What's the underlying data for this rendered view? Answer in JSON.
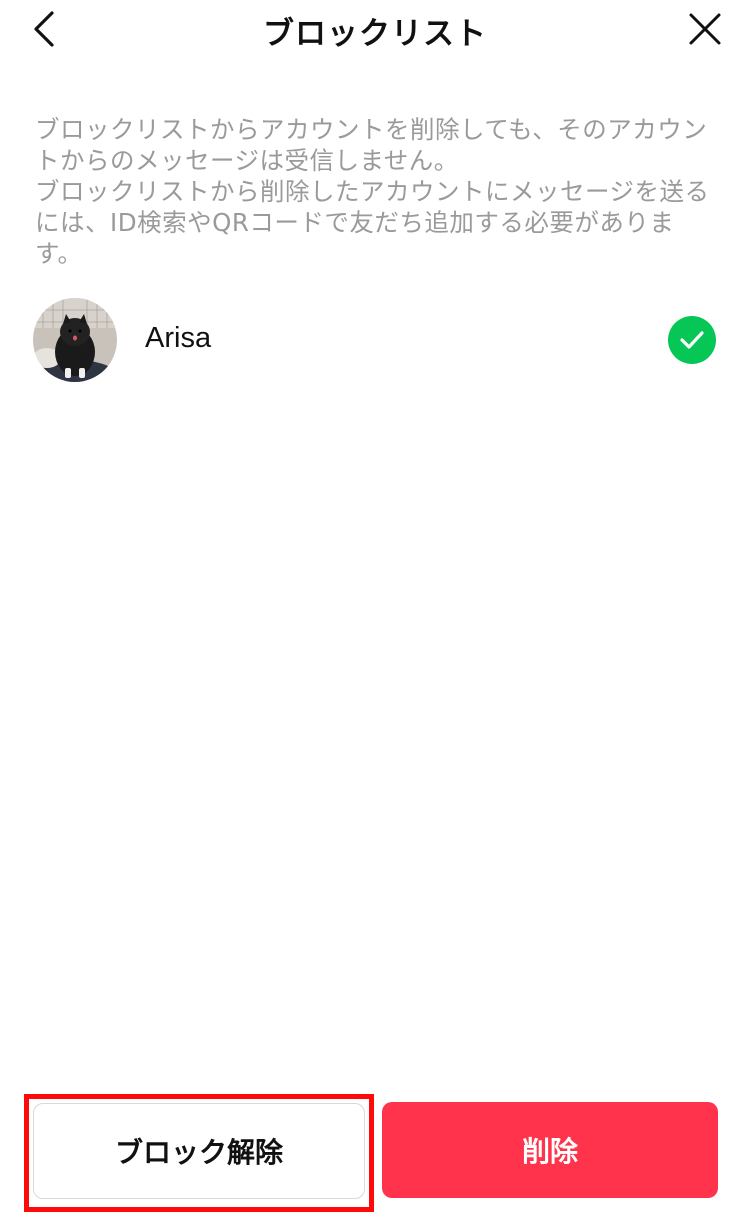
{
  "header": {
    "title": "ブロックリスト",
    "back_icon": "chevron-left-icon",
    "close_icon": "close-icon"
  },
  "description": {
    "paragraph1": "ブロックリストからアカウントを削除しても、そのアカウントからのメッセージは受信しません。",
    "paragraph2": "ブロックリストから削除したアカウントにメッセージを送るには、ID検索やQRコードで友だち追加する必要があります。"
  },
  "blocked_users": [
    {
      "name": "Arisa",
      "avatar_icon": "dog-avatar",
      "selected": true
    }
  ],
  "footer": {
    "unblock_label": "ブロック解除",
    "delete_label": "削除"
  },
  "colors": {
    "check_green": "#06c755",
    "delete_red": "#ff334b",
    "highlight_red": "#ff0a0a",
    "description_gray": "#9a9a9a"
  }
}
